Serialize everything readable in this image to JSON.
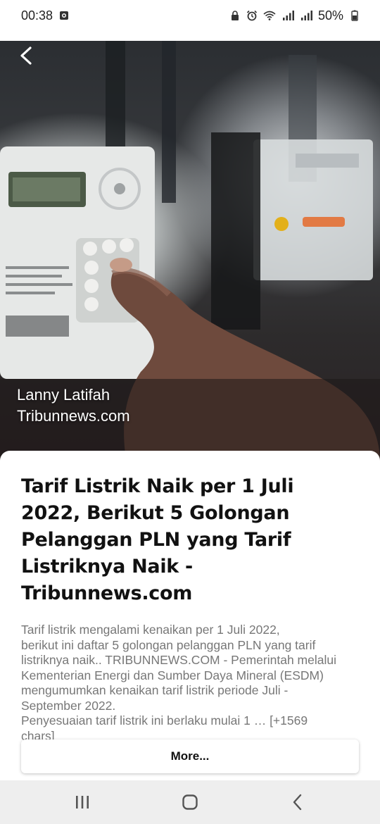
{
  "status_bar": {
    "time": "00:38",
    "battery_percent": "50%",
    "icons": [
      "screenshot-icon",
      "lock-icon",
      "alarm-icon",
      "wifi-icon",
      "signal-icon",
      "signal-icon",
      "battery-icon"
    ]
  },
  "hero": {
    "author": "Lanny Latifah",
    "source": "Tribunnews.com",
    "back_icon": "chevron-left-icon"
  },
  "article": {
    "title": "Tarif Listrik Naik per 1 Juli 2022, Berikut 5 Golongan Pelanggan PLN yang Tarif Listriknya Naik - Tribunnews.com",
    "description": "Tarif listrik mengalami kenaikan per 1 Juli 2022,\nberikut ini daftar 5 golongan pelanggan PLN yang tarif\nlistriknya naik.. TRIBUNNEWS.COM - Pemerintah melalui\nKementerian Energi dan Sumber Daya Mineral (ESDM)\nmengumumkan kenaikan tarif listrik periode Juli -\nSeptember 2022.\nPenyesuaian tarif listrik ini berlaku mulai 1 … [+1569\nchars]",
    "more_label": "More..."
  },
  "nav_bar": {
    "icons": [
      "recent-apps-icon",
      "home-icon",
      "back-icon"
    ]
  },
  "colors": {
    "title": "#111111",
    "description": "#777777",
    "nav_background": "#eeeeee"
  }
}
